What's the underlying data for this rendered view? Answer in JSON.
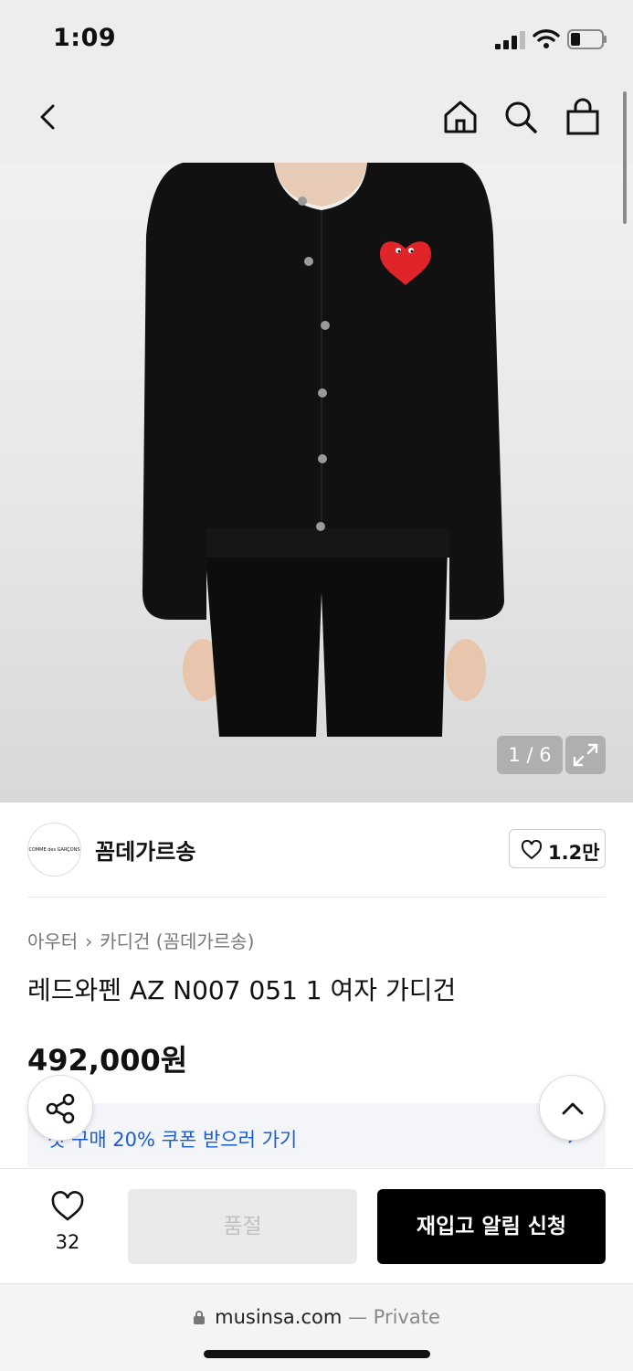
{
  "status_bar": {
    "time": "1:09"
  },
  "nav": {
    "back_icon": "chevron-left-icon",
    "home_icon": "home-icon",
    "search_icon": "search-icon",
    "cart_icon": "shopping-bag-icon"
  },
  "gallery": {
    "counter": "1 / 6",
    "expand_icon": "expand-icon"
  },
  "brand": {
    "logo_text": "COMME des GARÇONS",
    "name": "꼼데가르송",
    "likes": "1.2만"
  },
  "product": {
    "breadcrumb": [
      "아우터",
      "카디건 (꼼데가르송)"
    ],
    "title": "레드와펜 AZ N007 051 1 여자 가디건",
    "price": "492,000원"
  },
  "coupon": {
    "text": "첫 구매 20% 쿠폰 받으러 가기"
  },
  "actions": {
    "wish_count": "32",
    "soldout_label": "품절",
    "restock_label": "재입고 알림 신청"
  },
  "browser": {
    "url": "musinsa.com",
    "mode": "— Private"
  },
  "colors": {
    "accent": "#1a5bd8",
    "primary_button": "#000000",
    "disabled_button": "#eaeaea"
  }
}
